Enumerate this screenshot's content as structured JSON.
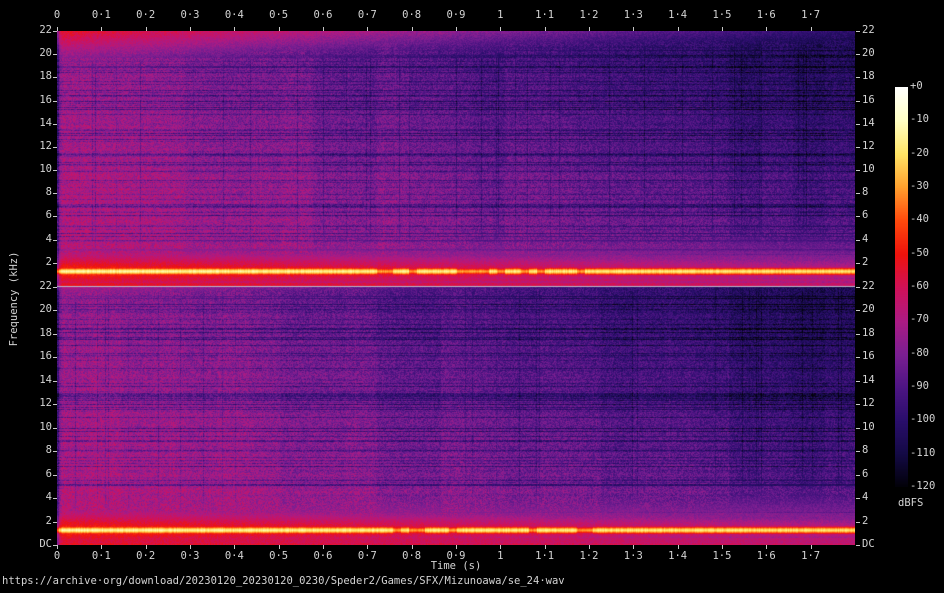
{
  "url_caption": "https://archive·org/download/20230120_20230120_0230/Speder2/Games/SFX/Mizunoawa/se_24·wav",
  "axes": {
    "time_label": "Time (s)",
    "freq_label": "Frequency (kHz)",
    "time_ticks": [
      "0",
      "0·1",
      "0·2",
      "0·3",
      "0·4",
      "0·5",
      "0·6",
      "0·7",
      "0·8",
      "0·9",
      "1",
      "1·1",
      "1·2",
      "1·3",
      "1·4",
      "1·5",
      "1·6",
      "1·7"
    ],
    "freq_ticks": [
      "22",
      "20",
      "18",
      "16",
      "14",
      "12",
      "10",
      "8",
      "6",
      "4",
      "2"
    ],
    "dc_label": "DC"
  },
  "colorbar": {
    "unit": "dBFS",
    "labels": [
      "+0",
      "-10",
      "-20",
      "-30",
      "-40",
      "-50",
      "-60",
      "-70",
      "-80",
      "-90",
      "-100",
      "-110",
      "-120"
    ],
    "palette_stops": [
      {
        "db": 0,
        "color": "#ffffff"
      },
      {
        "db": -10,
        "color": "#ffffc4"
      },
      {
        "db": -20,
        "color": "#ffe566"
      },
      {
        "db": -30,
        "color": "#ffa02e"
      },
      {
        "db": -40,
        "color": "#ff4a0d"
      },
      {
        "db": -50,
        "color": "#ef130c"
      },
      {
        "db": -60,
        "color": "#d11158"
      },
      {
        "db": -70,
        "color": "#ad1b84"
      },
      {
        "db": -80,
        "color": "#7c1f92"
      },
      {
        "db": -90,
        "color": "#4e1584"
      },
      {
        "db": -100,
        "color": "#2a0e6c"
      },
      {
        "db": -110,
        "color": "#140a46"
      },
      {
        "db": -120,
        "color": "#020108"
      }
    ]
  },
  "colors": {
    "background": "#000000",
    "text": "#d4d4d4",
    "panel_separator": "#b9b9d0"
  },
  "chart_data": {
    "type": "heatmap",
    "subtype": "stereo-audio-spectrogram",
    "caption": "https://archive·org/download/20230120_20230120_0230/Speder2/Games/SFX/Mizunoawa/se_24·wav",
    "panels": [
      {
        "name": "channel-1",
        "position": "top"
      },
      {
        "name": "channel-2",
        "position": "bottom"
      }
    ],
    "x_axis": {
      "label": "Time (s)",
      "min": 0,
      "max": 1.8,
      "tick_interval": 0.1,
      "tick_labels": [
        "0",
        "0·1",
        "0·2",
        "0·3",
        "0·4",
        "0·5",
        "0·6",
        "0·7",
        "0·8",
        "0·9",
        "1",
        "1·1",
        "1·2",
        "1·3",
        "1·4",
        "1·5",
        "1·6",
        "1·7"
      ]
    },
    "y_axis": {
      "label": "Frequency (kHz)",
      "min": 0,
      "max": 22,
      "tick_interval": 2,
      "bottom_tick_label": "DC"
    },
    "color_axis": {
      "label": "dBFS",
      "max": 0,
      "min": -120,
      "tick_interval": 10,
      "tick_labels": [
        "+0",
        "-10",
        "-20",
        "-30",
        "-40",
        "-50",
        "-60",
        "-70",
        "-80",
        "-90",
        "-100",
        "-110",
        "-120"
      ]
    },
    "legend_position": "right-colorbar",
    "grid": false,
    "content_summary": [
      "steady tone at ~1.3 kHz at roughly -13 to -19 dBFS spanning the full 0-1.8 s in both channels (bright yellow line)",
      "tone line becomes intermittent/dashed between ~0.75 s and ~1.3 s",
      "red low-frequency energy band below ~2.5 kHz at ~-45 to -60 dBFS",
      "broadband purple noise floor ~-70 dBFS at t=0 decaying to ~-100 dBFS (dark navy) by t=1.8 s, high frequencies decaying fastest",
      "extra energy near the 22 kHz edge of channel 1 (red/pink) fading after ~1.1 s"
    ]
  }
}
